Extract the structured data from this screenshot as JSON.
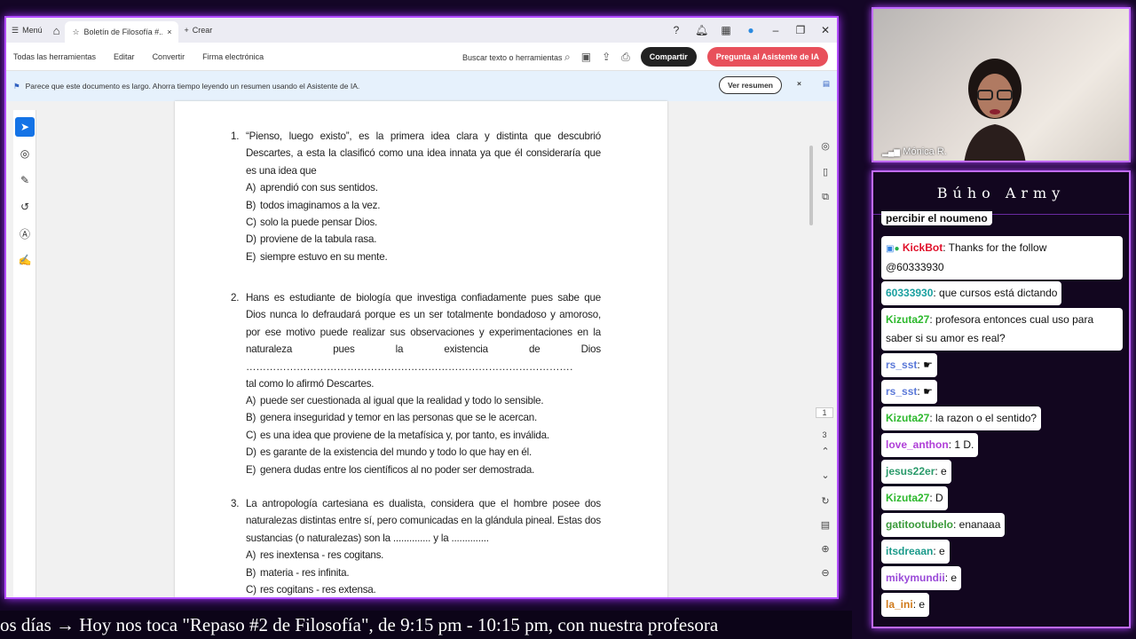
{
  "titlebar": {
    "menu": "Menú",
    "tab_title": "Boletín de Filosofía #...",
    "create": "Crear"
  },
  "menubar": {
    "items": [
      "Todas las herramientas",
      "Editar",
      "Convertir",
      "Firma electrónica"
    ],
    "search_text": "Buscar texto o herramientas",
    "share": "Compartir",
    "ai": "Pregunta al Asistente de IA"
  },
  "banner": {
    "message": "Parece que este documento es largo. Ahorra tiempo leyendo un resumen usando el Asistente de IA.",
    "button": "Ver resumen",
    "close": "×"
  },
  "doc": {
    "q1": {
      "num": "1.",
      "text": "“Pienso, luego existo”, es la primera idea clara y distinta que descubrió Descartes, a esta la clasificó como una idea innata ya que él consideraría que es una idea que",
      "options": [
        {
          "letter": "A)",
          "text": "aprendió con sus sentidos."
        },
        {
          "letter": "B)",
          "text": "todos imaginamos a la vez."
        },
        {
          "letter": "C)",
          "text": "solo la puede pensar Dios."
        },
        {
          "letter": "D)",
          "text": "proviene de la tabula rasa."
        },
        {
          "letter": "E)",
          "text": "siempre estuvo en su mente."
        }
      ]
    },
    "q2": {
      "num": "2.",
      "text": "Hans es estudiante de biología que investiga confiadamente pues sabe que Dios nunca lo defraudará porque es un ser totalmente bondadoso y amoroso, por ese motivo puede realizar sus observaciones y experimentaciones en la naturaleza pues la existencia de Dios",
      "dots": "……………………………………………………………………………………………",
      "tail": "tal como lo afirmó Descartes.",
      "options": [
        {
          "letter": "A)",
          "text": "puede ser cuestionada al igual que la realidad y todo lo sensible."
        },
        {
          "letter": "B)",
          "text": "genera inseguridad y temor en las personas que se le acercan."
        },
        {
          "letter": "C)",
          "text": "es una idea que proviene de la metafísica y, por tanto, es inválida."
        },
        {
          "letter": "D)",
          "text": "es garante de la existencia del mundo y todo lo que hay en él."
        },
        {
          "letter": "E)",
          "text": "genera dudas entre los científicos al no poder ser demostrada."
        }
      ]
    },
    "q3": {
      "num": "3.",
      "text": "La antropología cartesiana es dualista, considera que el hombre posee dos naturalezas distintas entre sí, pero comunicadas en la glándula pineal. Estas dos sustancias (o naturalezas) son la .............. y la ..............",
      "options": [
        {
          "letter": "A)",
          "text": "res inextensa - res cogitans."
        },
        {
          "letter": "B)",
          "text": "materia - res infinita."
        },
        {
          "letter": "C)",
          "text": "res cogitans - res extensa."
        }
      ]
    },
    "page_indicator": {
      "current": "1",
      "total": "3"
    }
  },
  "webcam": {
    "name": "Mónica R."
  },
  "chat": {
    "title": "Búho Army",
    "partial_text": "percibir el noumeno",
    "messages": [
      {
        "user": "KickBot",
        "text": ": Thanks for the follow",
        "text2": "@60333930",
        "color": "#e0102a"
      },
      {
        "user": "60333930",
        "text": ": que cursos está dictando",
        "color": "#1aa0a0"
      },
      {
        "user": "Kizuta27",
        "text": ": profesora entonces cual uso para",
        "text2": "saber si su amor es real?",
        "color": "#2cb82c"
      },
      {
        "user": "rs_sst",
        "text": ":",
        "color": "#5a78d8"
      },
      {
        "user": "rs_sst",
        "text": ":",
        "color": "#5a78d8"
      },
      {
        "user": "Kizuta27",
        "text": ": la razon o el sentido?",
        "color": "#2cb82c"
      },
      {
        "user": "love_anthon",
        "text": ": 1 D.",
        "color": "#b040d8"
      },
      {
        "user": "jesus22er",
        "text": ": e",
        "color": "#2a9a6a"
      },
      {
        "user": "Kizuta27",
        "text": ": D",
        "color": "#2cb82c"
      },
      {
        "user": "gatitootubelo",
        "text": ": enanaaa",
        "color": "#3a9a3a"
      },
      {
        "user": "itsdreaan",
        "text": ": e",
        "color": "#1a9a8a"
      },
      {
        "user": "mikymundii",
        "text": ": e",
        "color": "#9a4ad8"
      },
      {
        "user": "la_ini",
        "text": ": e",
        "color": "#d07a1a"
      }
    ]
  },
  "ticker": {
    "text": "os días  →  Hoy nos toca \"Repaso #2 de Filosofía\", de 9:15 pm - 10:15 pm, con nuestra profesora"
  }
}
